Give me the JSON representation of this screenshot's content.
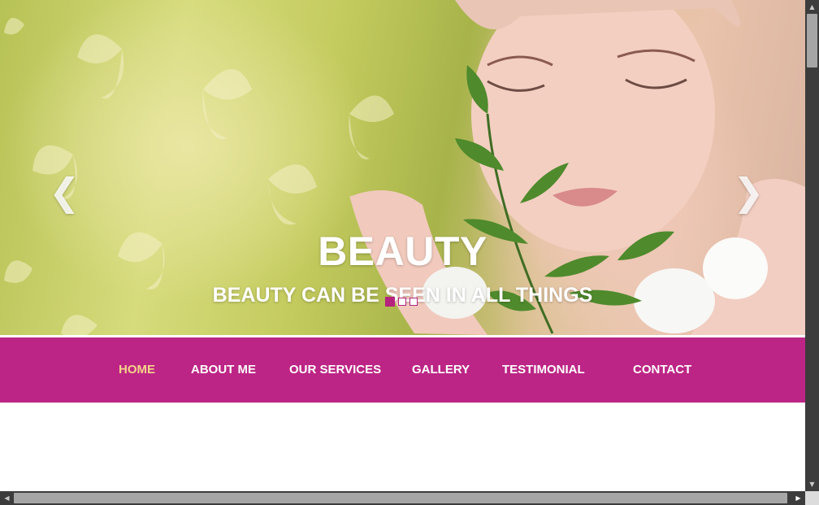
{
  "hero": {
    "title": "BEAUTY",
    "subtitle": "BEAUTY CAN BE SEEN IN ALL THINGS",
    "prev_icon": "❮",
    "next_icon": "❯",
    "slides_total": 3,
    "active_slide": 1
  },
  "nav": {
    "items": [
      {
        "label": "HOME",
        "active": true
      },
      {
        "label": "ABOUT ME",
        "active": false
      },
      {
        "label": "OUR SERVICES",
        "active": false
      },
      {
        "label": "GALLERY",
        "active": false
      },
      {
        "label": "TESTIMONIAL",
        "active": false
      },
      {
        "label": "CONTACT",
        "active": false
      }
    ]
  },
  "colors": {
    "brand": "#bc2585",
    "active_nav": "#f6d48a",
    "nav_text": "#ffffff"
  },
  "scrollbars": {
    "up_icon": "▲",
    "down_icon": "▼",
    "left_icon": "◀",
    "right_icon": "▶"
  }
}
